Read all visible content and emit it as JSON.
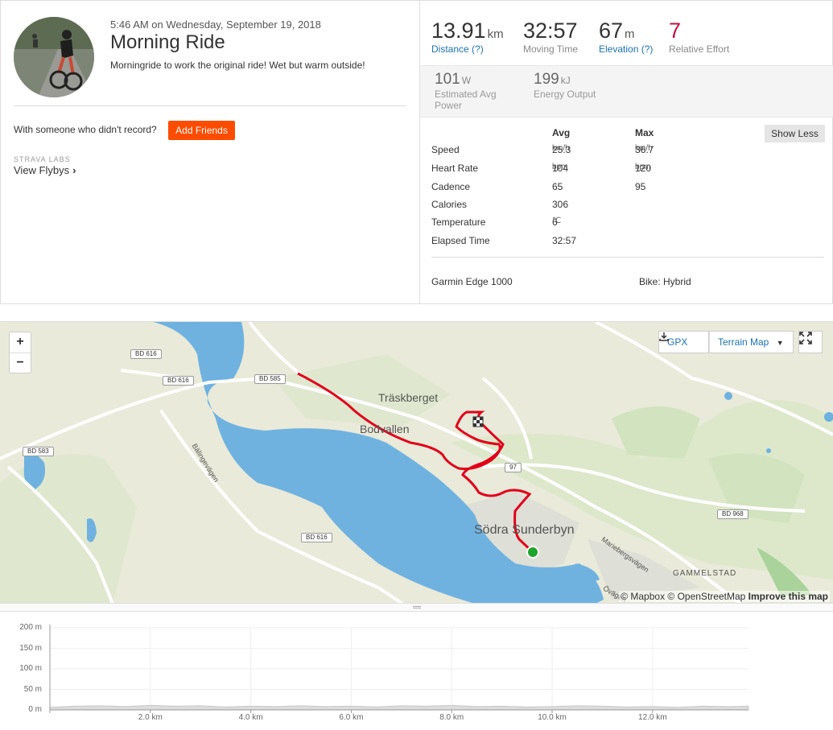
{
  "activity": {
    "date": "5:46 AM on Wednesday, September 19, 2018",
    "title": "Morning Ride",
    "description": "Morningride to work the original ride! Wet but warm outside!",
    "with_someone": "With someone who didn't record?",
    "add_friends": "Add Friends",
    "labs_label": "STRAVA LABS",
    "flybys": "View Flybys"
  },
  "stats": {
    "distance": {
      "value": "13.91",
      "unit": "km",
      "label": "Distance (?)"
    },
    "moving_time": {
      "value": "32:57",
      "label": "Moving Time"
    },
    "elevation": {
      "value": "67",
      "unit": "m",
      "label": "Elevation (?)"
    },
    "relative_effort": {
      "value": "7",
      "label": "Relative Effort"
    },
    "power": {
      "value": "101",
      "unit": "W",
      "label_line1": "Estimated Avg",
      "label_line2": "Power"
    },
    "energy": {
      "value": "199",
      "unit": "kJ",
      "label": "Energy Output"
    }
  },
  "table": {
    "avg_header": "Avg",
    "max_header": "Max",
    "show_less": "Show Less",
    "rows": [
      {
        "label": "Speed",
        "avg": "25.3",
        "avg_unit": "km/h",
        "max": "36.7",
        "max_unit": "km/h"
      },
      {
        "label": "Heart Rate",
        "avg": "104",
        "avg_unit": "bpm",
        "max": "120",
        "max_unit": "bpm"
      },
      {
        "label": "Cadence",
        "avg": "65",
        "avg_unit": "",
        "max": "95",
        "max_unit": ""
      },
      {
        "label": "Calories",
        "avg": "306",
        "avg_unit": "",
        "max": "",
        "max_unit": ""
      },
      {
        "label": "Temperature",
        "avg": "6",
        "avg_unit": "℃",
        "max": "",
        "max_unit": ""
      },
      {
        "label": "Elapsed Time",
        "avg": "32:57",
        "avg_unit": "",
        "max": "",
        "max_unit": ""
      }
    ],
    "device": "Garmin Edge 1000",
    "bike": "Bike: Hybrid"
  },
  "map": {
    "zoom_in": "+",
    "zoom_out": "−",
    "gpx": "GPX",
    "terrain": "Terrain Map",
    "attribution_1": "© Mapbox © OpenStreetMap",
    "attribution_2": "Improve this map",
    "places": {
      "traskberget": "Träskberget",
      "bodvallen": "Bodvallen",
      "sodra": "Södra Sunderbyn",
      "gammelstad": "GAMMELSTAD"
    },
    "roads": {
      "bd616_a": "BD 616",
      "bd616_b": "BD 616",
      "bd585": "BD 585",
      "bd583": "BD 583",
      "bd616_c": "BD 616",
      "r97": "97",
      "bd968": "BD 968",
      "balinge": "Bälingevägen",
      "marieberg": "Mariebergsvägen",
      "ovag": "Övägen"
    },
    "colors": {
      "water": "#6fb2e0",
      "route": "#e2001a",
      "start": "#1ea52b"
    }
  },
  "chart_data": {
    "type": "area",
    "x_unit": "km",
    "x_ticks": [
      "2.0 km",
      "4.0 km",
      "6.0 km",
      "8.0 km",
      "10.0 km",
      "12.0 km"
    ],
    "y_ticks": [
      "200 m",
      "150 m",
      "100 m",
      "50 m",
      "0 m"
    ],
    "ylim": [
      0,
      200
    ],
    "xlim": [
      0,
      13.91
    ],
    "x": [
      0,
      0.5,
      1.0,
      1.5,
      2.0,
      2.5,
      3.0,
      3.5,
      4.0,
      4.5,
      5.0,
      5.5,
      6.0,
      6.5,
      7.0,
      7.5,
      8.0,
      8.5,
      9.0,
      9.5,
      10.0,
      10.5,
      11.0,
      11.5,
      12.0,
      12.5,
      13.0,
      13.5,
      13.91
    ],
    "elevation_m": [
      6,
      9,
      10,
      8,
      11,
      9,
      10,
      7,
      9,
      8,
      10,
      8,
      9,
      7,
      10,
      9,
      11,
      8,
      9,
      7,
      8,
      10,
      9,
      7,
      8,
      6,
      9,
      8,
      9
    ],
    "grid": true
  }
}
